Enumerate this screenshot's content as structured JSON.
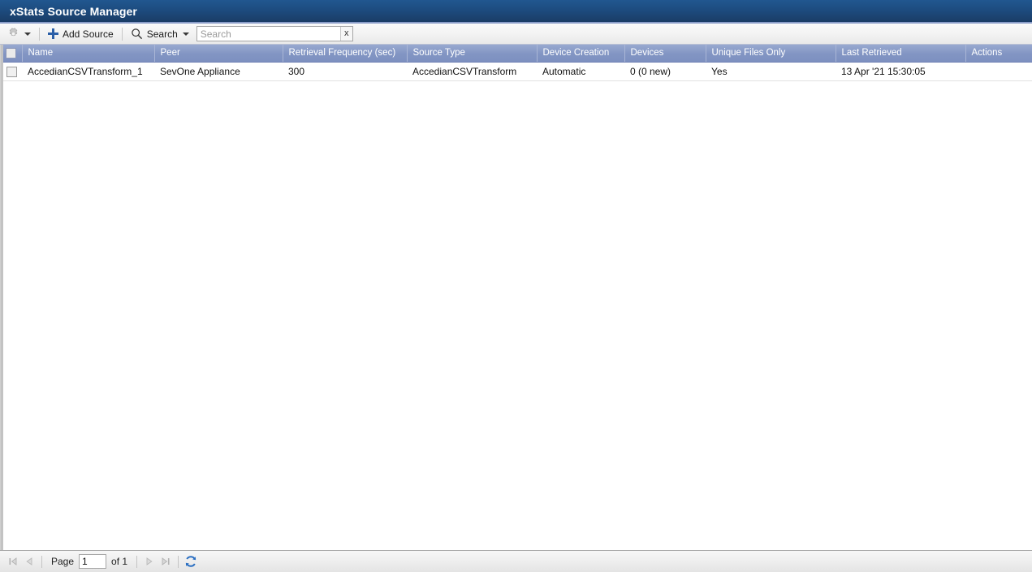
{
  "window": {
    "title": "xStats Source Manager"
  },
  "toolbar": {
    "settings_icon": "gear-icon",
    "settings_caret_icon": "caret-down-icon",
    "add_source_icon": "plus-icon",
    "add_source_label": "Add Source",
    "search_icon": "magnifier-icon",
    "search_menu_label": "Search",
    "search_menu_caret_icon": "caret-down-icon",
    "search_value": "",
    "search_placeholder": "Search",
    "search_clear_label": "x"
  },
  "grid": {
    "columns": [
      {
        "key": "checkbox",
        "label": ""
      },
      {
        "key": "name",
        "label": "Name"
      },
      {
        "key": "peer",
        "label": "Peer"
      },
      {
        "key": "retrieval_frequency",
        "label": "Retrieval Frequency (sec)"
      },
      {
        "key": "source_type",
        "label": "Source Type"
      },
      {
        "key": "device_creation",
        "label": "Device Creation"
      },
      {
        "key": "devices",
        "label": "Devices"
      },
      {
        "key": "unique_files_only",
        "label": "Unique Files Only"
      },
      {
        "key": "last_retrieved",
        "label": "Last Retrieved"
      },
      {
        "key": "actions",
        "label": "Actions"
      }
    ],
    "select_all_checked": false,
    "rows": [
      {
        "checked": false,
        "name": "AccedianCSVTransform_1",
        "peer": "SevOne Appliance",
        "retrieval_frequency": "300",
        "source_type": "AccedianCSVTransform",
        "device_creation": "Automatic",
        "devices": "0 (0 new)",
        "unique_files_only": "Yes",
        "last_retrieved": "13 Apr '21 15:30:05",
        "actions": ""
      }
    ]
  },
  "pager": {
    "first_icon": "first-page-icon",
    "prev_icon": "previous-page-icon",
    "page_label": "Page",
    "page_value": "1",
    "of_label": "of 1",
    "next_icon": "next-page-icon",
    "last_icon": "last-page-icon",
    "refresh_icon": "refresh-icon"
  },
  "colors": {
    "titlebar_top": "#215790",
    "titlebar_bottom": "#1a3c66",
    "header_row": "#8295c3",
    "accent_blue": "#2b5fa8",
    "divider": "#8a9dc9"
  }
}
